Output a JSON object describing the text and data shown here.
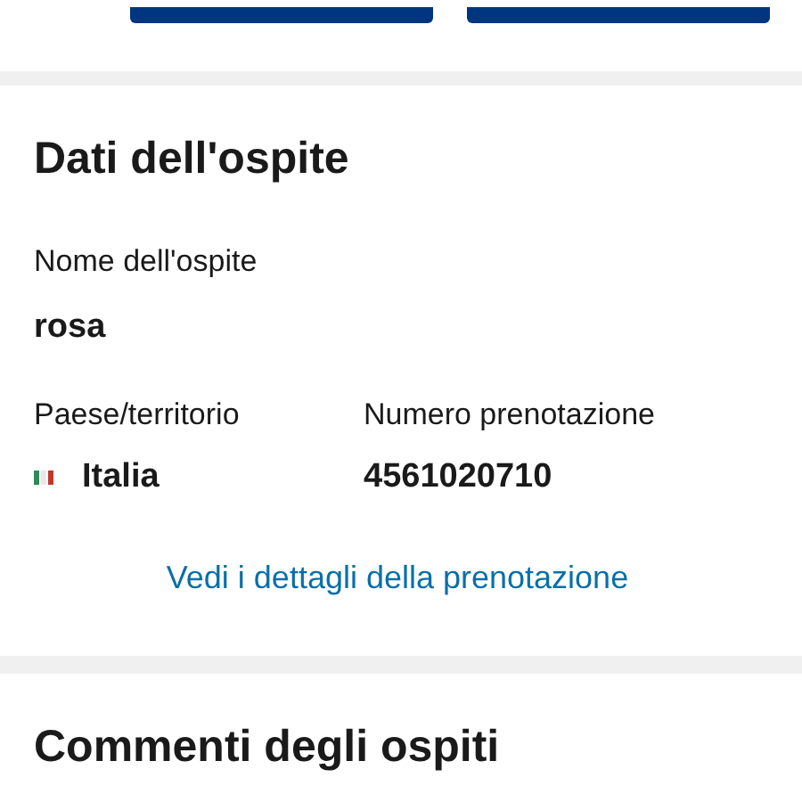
{
  "top_buttons": [
    {
      "kind": "button"
    },
    {
      "kind": "button"
    }
  ],
  "guest_section": {
    "title": "Dati dell'ospite",
    "name_label": "Nome dell'ospite",
    "name_value": "rosa",
    "country_label": "Paese/territorio",
    "country_value": "Italia",
    "booking_label": "Numero prenotazione",
    "booking_value": "4561020710",
    "link": "Vedi i dettagli della prenotazione"
  },
  "comments_section": {
    "title": "Commenti degli ospiti"
  }
}
